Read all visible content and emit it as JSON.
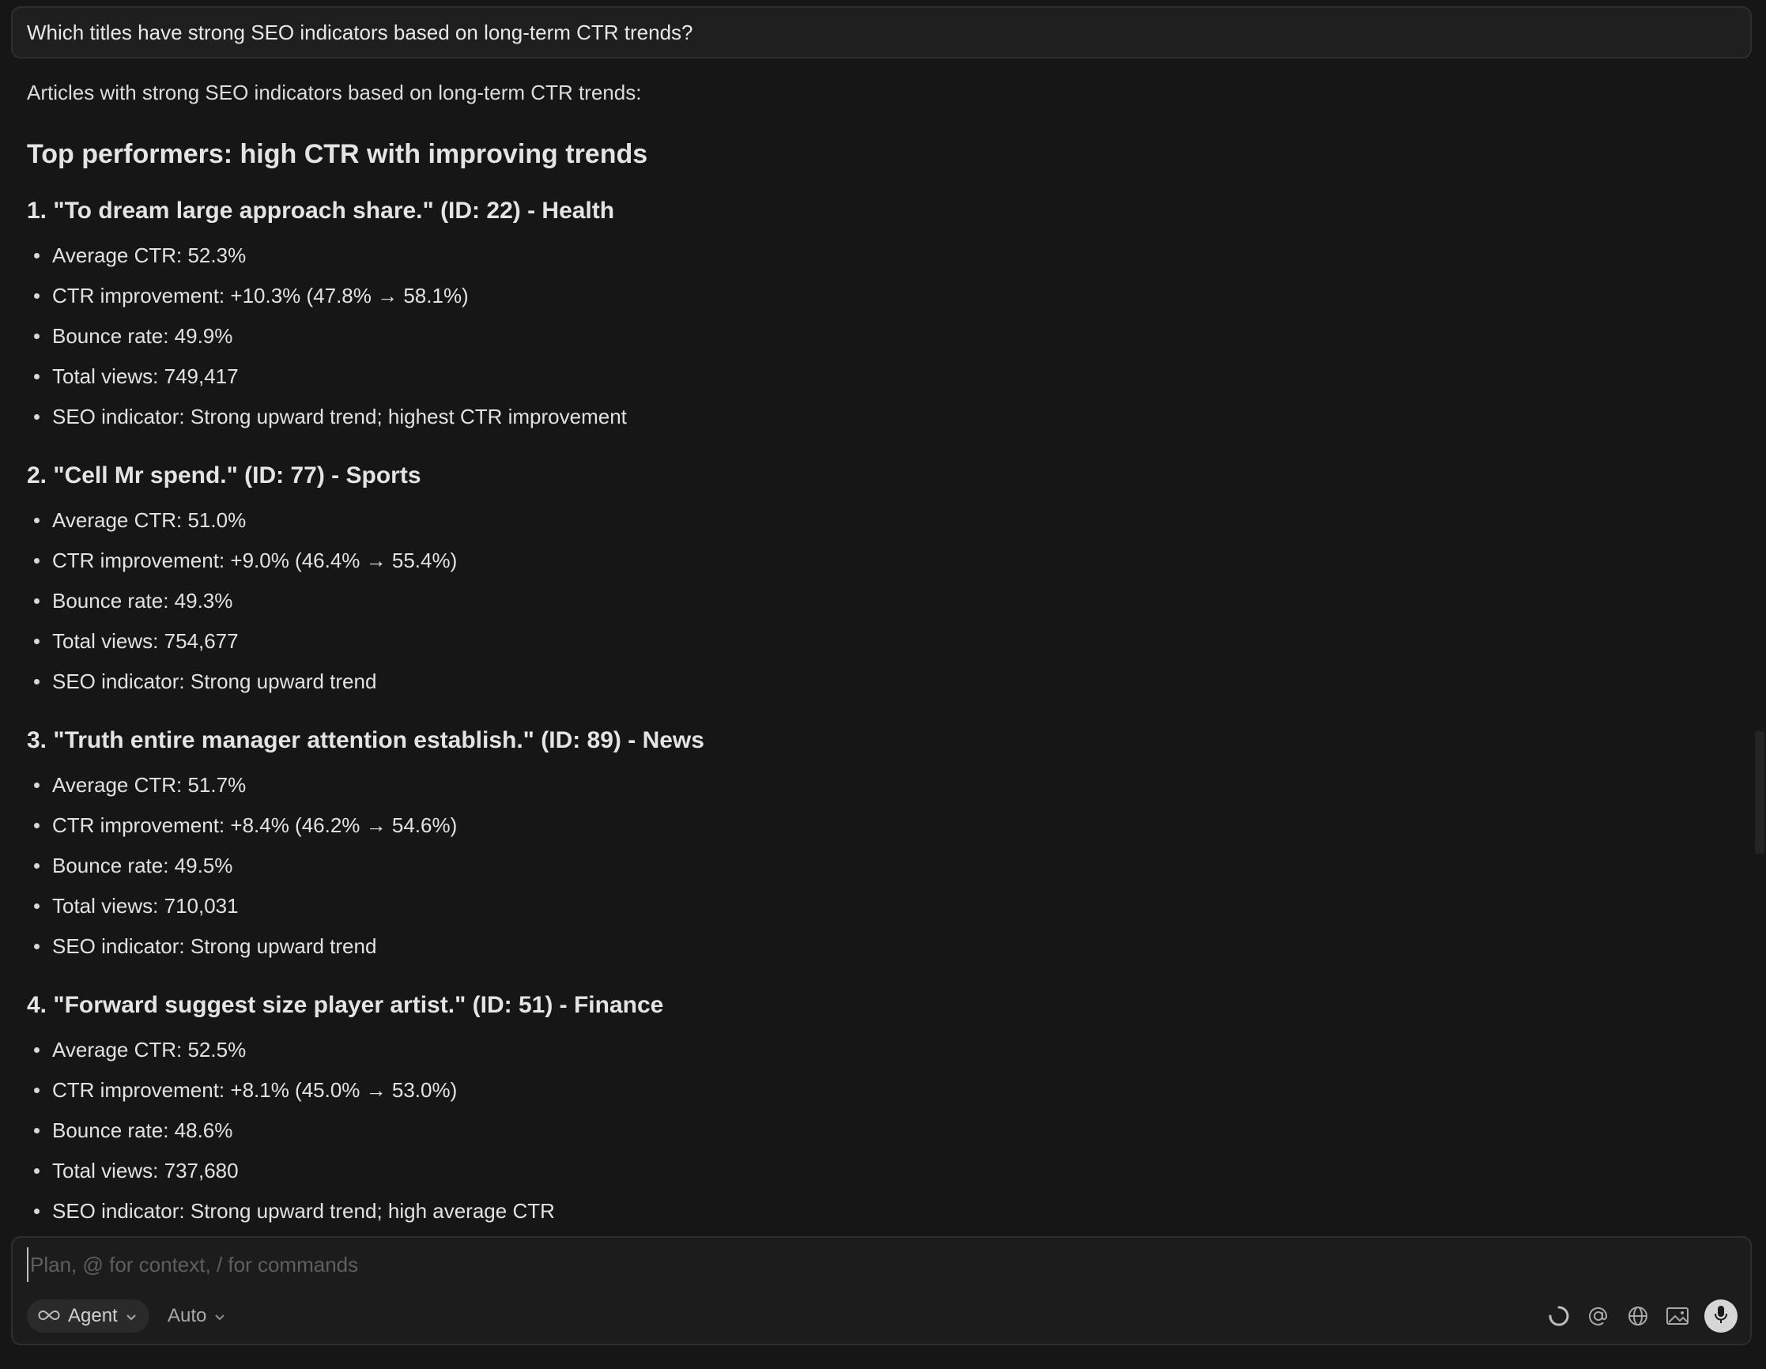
{
  "query": "Which titles have strong SEO indicators based on long-term CTR trends?",
  "answer": {
    "intro": "Articles with strong SEO indicators based on long-term CTR trends:",
    "section_heading": "Top performers: high CTR with improving trends",
    "items": [
      {
        "title": "1. \"To dream large approach share.\" (ID: 22) - Health",
        "bullets": [
          "Average CTR: 52.3%",
          "CTR improvement: +10.3% (47.8% → 58.1%)",
          "Bounce rate: 49.9%",
          "Total views: 749,417",
          "SEO indicator: Strong upward trend; highest CTR improvement"
        ]
      },
      {
        "title": "2. \"Cell Mr spend.\" (ID: 77) - Sports",
        "bullets": [
          "Average CTR: 51.0%",
          "CTR improvement: +9.0% (46.4% → 55.4%)",
          "Bounce rate: 49.3%",
          "Total views: 754,677",
          "SEO indicator: Strong upward trend"
        ]
      },
      {
        "title": "3. \"Truth entire manager attention establish.\" (ID: 89) - News",
        "bullets": [
          "Average CTR: 51.7%",
          "CTR improvement: +8.4% (46.2% → 54.6%)",
          "Bounce rate: 49.5%",
          "Total views: 710,031",
          "SEO indicator: Strong upward trend"
        ]
      },
      {
        "title": "4. \"Forward suggest size player artist.\" (ID: 51) - Finance",
        "bullets": [
          "Average CTR: 52.5%",
          "CTR improvement: +8.1% (45.0% → 53.0%)",
          "Bounce rate: 48.6%",
          "Total views: 737,680",
          "SEO indicator: Strong upward trend; high average CTR"
        ]
      }
    ]
  },
  "composer": {
    "placeholder": "Plan, @ for context, / for commands",
    "value": "",
    "agent_label": "Agent",
    "model_label": "Auto",
    "icons": [
      "loading-spinner-icon",
      "at-mention-icon",
      "globe-icon",
      "image-icon",
      "microphone-icon"
    ]
  }
}
